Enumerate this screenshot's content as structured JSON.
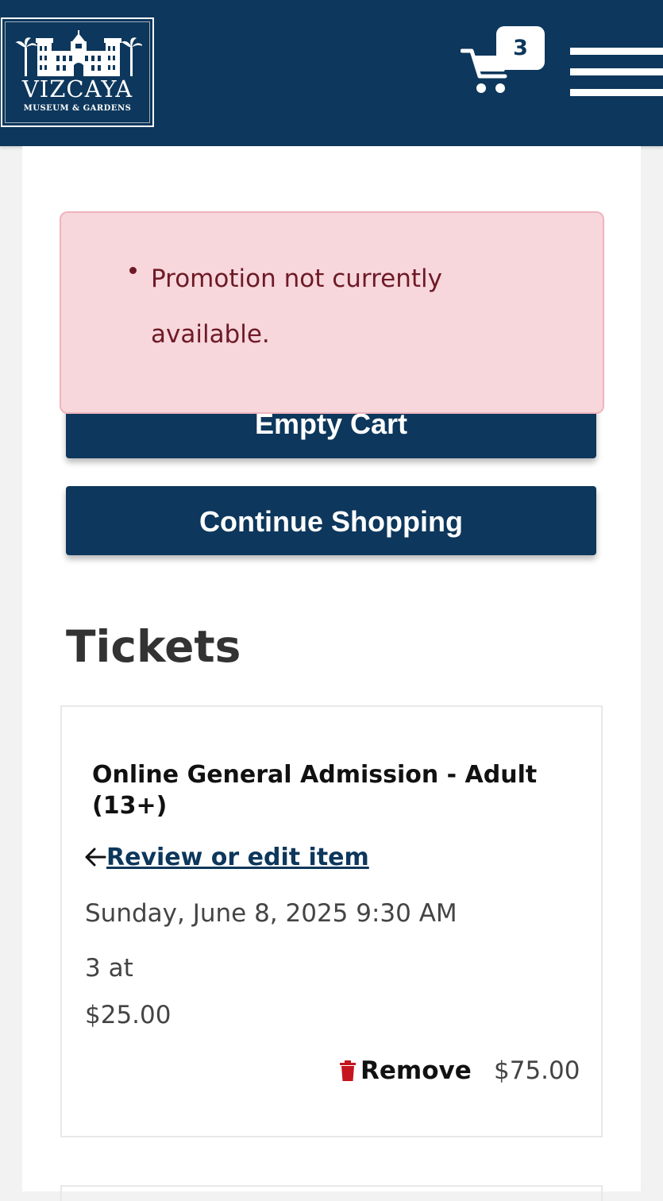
{
  "header": {
    "logo_title": "VIZCAYA",
    "logo_subtitle": "MUSEUM & GARDENS",
    "cart_count": "3",
    "colors": {
      "brand": "#0d375c",
      "text_on_brand": "#ffffff"
    },
    "icons": {
      "cart": "cart-icon",
      "menu": "hamburger-menu-icon"
    }
  },
  "alert": {
    "message": "Promotion not currently available.",
    "colors": {
      "background": "#f7d7dc",
      "border": "#eeb4bd",
      "text": "#6e1a26"
    }
  },
  "actions": {
    "empty_cart_label": "Empty Cart",
    "continue_shopping_label": "Continue Shopping"
  },
  "tickets": {
    "section_title": "Tickets",
    "items": [
      {
        "name": "Online General Admission - Adult (13+)",
        "review_link": "Review or edit item",
        "date": "Sunday, June 8, 2025 9:30 AM",
        "quantity_text": "3 at",
        "unit_price": "$25.00",
        "remove_label": "Remove",
        "line_total": "$75.00",
        "icons": {
          "back": "arrow-left-icon",
          "remove": "trash-icon"
        },
        "colors": {
          "trash": "#c4161c"
        }
      }
    ]
  }
}
